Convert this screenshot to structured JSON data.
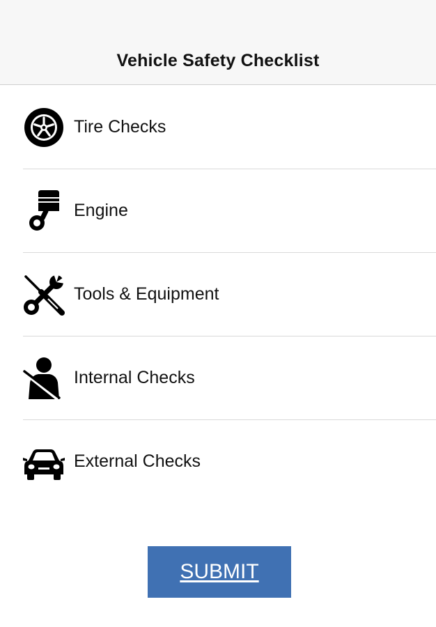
{
  "header": {
    "title": "Vehicle Safety Checklist"
  },
  "checklist": {
    "items": [
      {
        "label": "Tire Checks",
        "icon": "tire-icon"
      },
      {
        "label": "Engine",
        "icon": "engine-piston-icon"
      },
      {
        "label": "Tools & Equipment",
        "icon": "tools-icon"
      },
      {
        "label": "Internal Checks",
        "icon": "seatbelt-icon"
      },
      {
        "label": "External Checks",
        "icon": "car-icon"
      }
    ]
  },
  "actions": {
    "submit_label": "SUBMIT"
  },
  "colors": {
    "accent": "#4071b3",
    "nav_background": "#f7f7f7",
    "separator": "#d9d9d9"
  }
}
